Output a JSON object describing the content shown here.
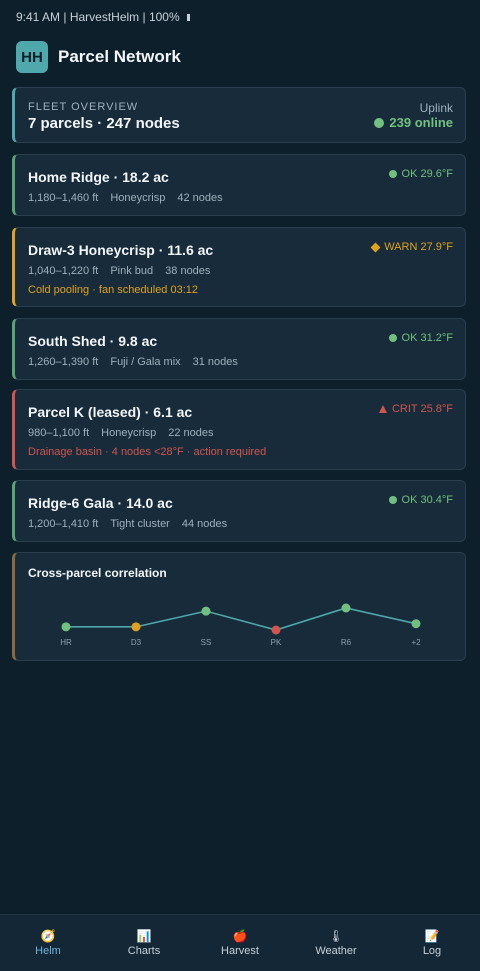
{
  "status_bar": {
    "text": "9:41 AM | HarvestHelm | 100%"
  },
  "header": {
    "icon_text": "HH",
    "title": "Parcel Network"
  },
  "fleet": {
    "label": "FLEET OVERVIEW",
    "summary": "7 parcels · 247 nodes",
    "uplink_label": "Uplink",
    "uplink_value": "239 online"
  },
  "parcels": [
    {
      "name": "Home Ridge · 18.2 ac",
      "elevation": "1,180–1,460 ft",
      "variety": "Honeycrisp",
      "nodes": "42 nodes",
      "status": "OK 29.6°F",
      "level": "ok",
      "alert": ""
    },
    {
      "name": "Draw-3 Honeycrisp · 11.6 ac",
      "elevation": "1,040–1,220 ft",
      "variety": "Pink bud",
      "nodes": "38 nodes",
      "status": "WARN 27.9°F",
      "level": "warn",
      "alert": "Cold pooling · fan scheduled 03:12"
    },
    {
      "name": "South Shed · 9.8 ac",
      "elevation": "1,260–1,390 ft",
      "variety": "Fuji / Gala mix",
      "nodes": "31 nodes",
      "status": "OK 31.2°F",
      "level": "ok",
      "alert": ""
    },
    {
      "name": "Parcel K (leased) · 6.1 ac",
      "elevation": "980–1,100 ft",
      "variety": "Honeycrisp",
      "nodes": "22 nodes",
      "status": "CRIT 25.8°F",
      "level": "crit",
      "alert": "Drainage basin · 4 nodes <28°F · action required"
    },
    {
      "name": "Ridge-6 Gala · 14.0 ac",
      "elevation": "1,200–1,410 ft",
      "variety": "Tight cluster",
      "nodes": "44 nodes",
      "status": "OK 30.4°F",
      "level": "ok",
      "alert": ""
    }
  ],
  "correlation": {
    "title": "Cross-parcel correlation"
  },
  "chart_data": {
    "type": "line",
    "categories": [
      "HR",
      "D3",
      "SS",
      "PK",
      "R6",
      "+2"
    ],
    "values": [
      0.4,
      0.4,
      0.9,
      0.3,
      1.0,
      0.5
    ],
    "point_colors": [
      "#72c07f",
      "#e0a21e",
      "#72c07f",
      "#d0554e",
      "#72c07f",
      "#72c07f"
    ],
    "line_color": "#4fa8ab",
    "grid": false
  },
  "tabs": [
    {
      "icon": "compass-icon",
      "glyph": "🧭",
      "label": "Helm",
      "active": true
    },
    {
      "icon": "bar-chart-icon",
      "glyph": "📊",
      "label": "Charts",
      "active": false
    },
    {
      "icon": "apple-icon",
      "glyph": "🍎",
      "label": "Harvest",
      "active": false
    },
    {
      "icon": "thermometer-icon",
      "glyph": "🌡",
      "label": "Weather",
      "active": false
    },
    {
      "icon": "notepad-icon",
      "glyph": "📝",
      "label": "Log",
      "active": false
    }
  ],
  "colors": {
    "accent": "#4fa8ab",
    "ok": "#72c07f",
    "warn": "#e0a21e",
    "crit": "#d0554e",
    "background": "#0e1f2c"
  }
}
